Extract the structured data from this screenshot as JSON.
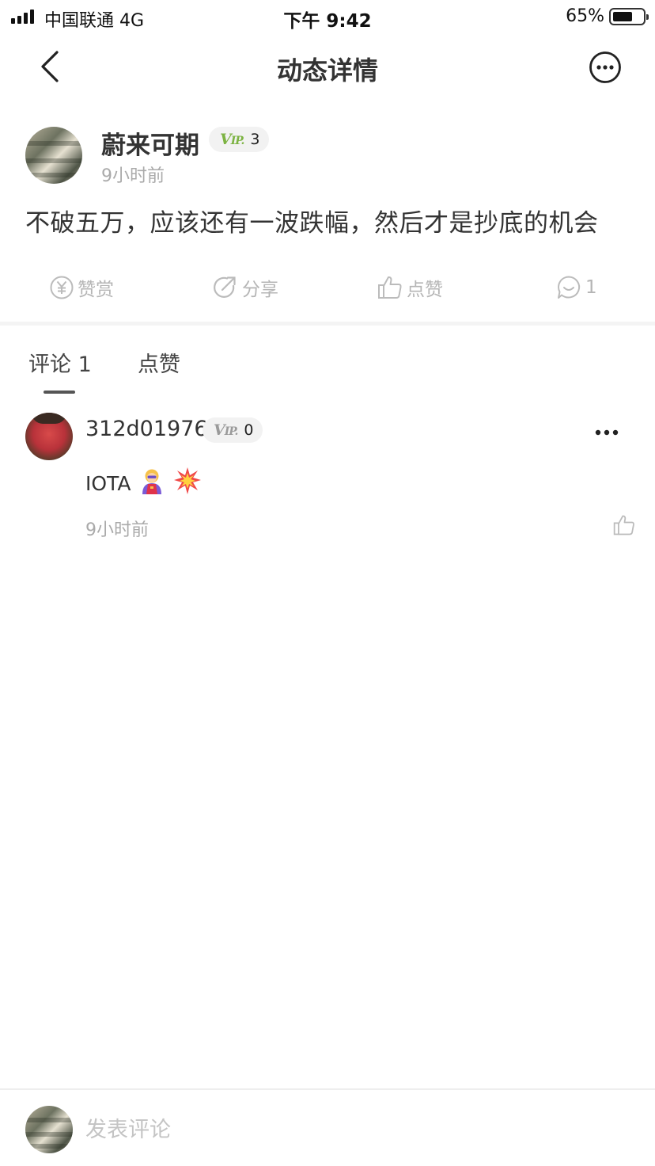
{
  "status_bar": {
    "carrier": "中国联通  4G",
    "time": "下午 9:42",
    "battery_percent": "65%",
    "battery_level": 0.65
  },
  "nav": {
    "title": "动态详情",
    "back_icon": "chevron-left-icon",
    "more_icon": "more-circle-icon"
  },
  "post": {
    "author": "蔚来可期",
    "vip_level": "3",
    "time": "9小时前",
    "content": "不破五万，应该还有一波跌幅，然后才是抄底的机会",
    "actions": {
      "reward": "赞赏",
      "share": "分享",
      "like": "点赞",
      "comment_count": "1"
    }
  },
  "tabs": {
    "comments": "评论 1",
    "likes": "点赞",
    "active": "comments"
  },
  "comments": [
    {
      "username": "312d01976",
      "vip_level": "0",
      "text": "IOTA",
      "emojis": [
        "🦸‍♀️",
        "💥"
      ],
      "time": "9小时前"
    }
  ],
  "footer": {
    "placeholder": "发表评论"
  },
  "colors": {
    "vip_active": "#7cb342",
    "vip_inactive": "#9a9a9a",
    "muted_text": "#aaaaaa",
    "action_text": "#b5b5b5"
  }
}
